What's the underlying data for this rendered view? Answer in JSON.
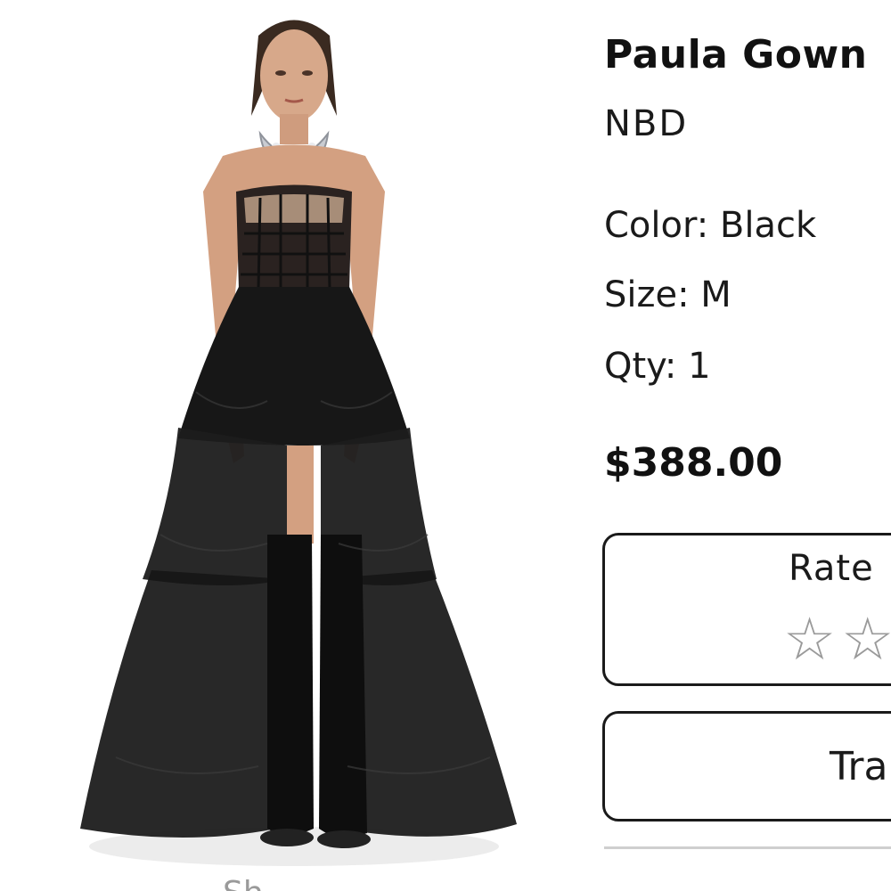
{
  "product": {
    "name": "Paula Gown",
    "brand": "NBD",
    "color_line": "Color: Black",
    "size_line": "Size: M",
    "qty_line": "Qty: 1",
    "price": "$388.00"
  },
  "rating": {
    "title": "Rate",
    "star_glyph": "☆",
    "value": 0
  },
  "actions": {
    "track_label": "Tra"
  },
  "image": {
    "caption_fragment": "Sh"
  }
}
